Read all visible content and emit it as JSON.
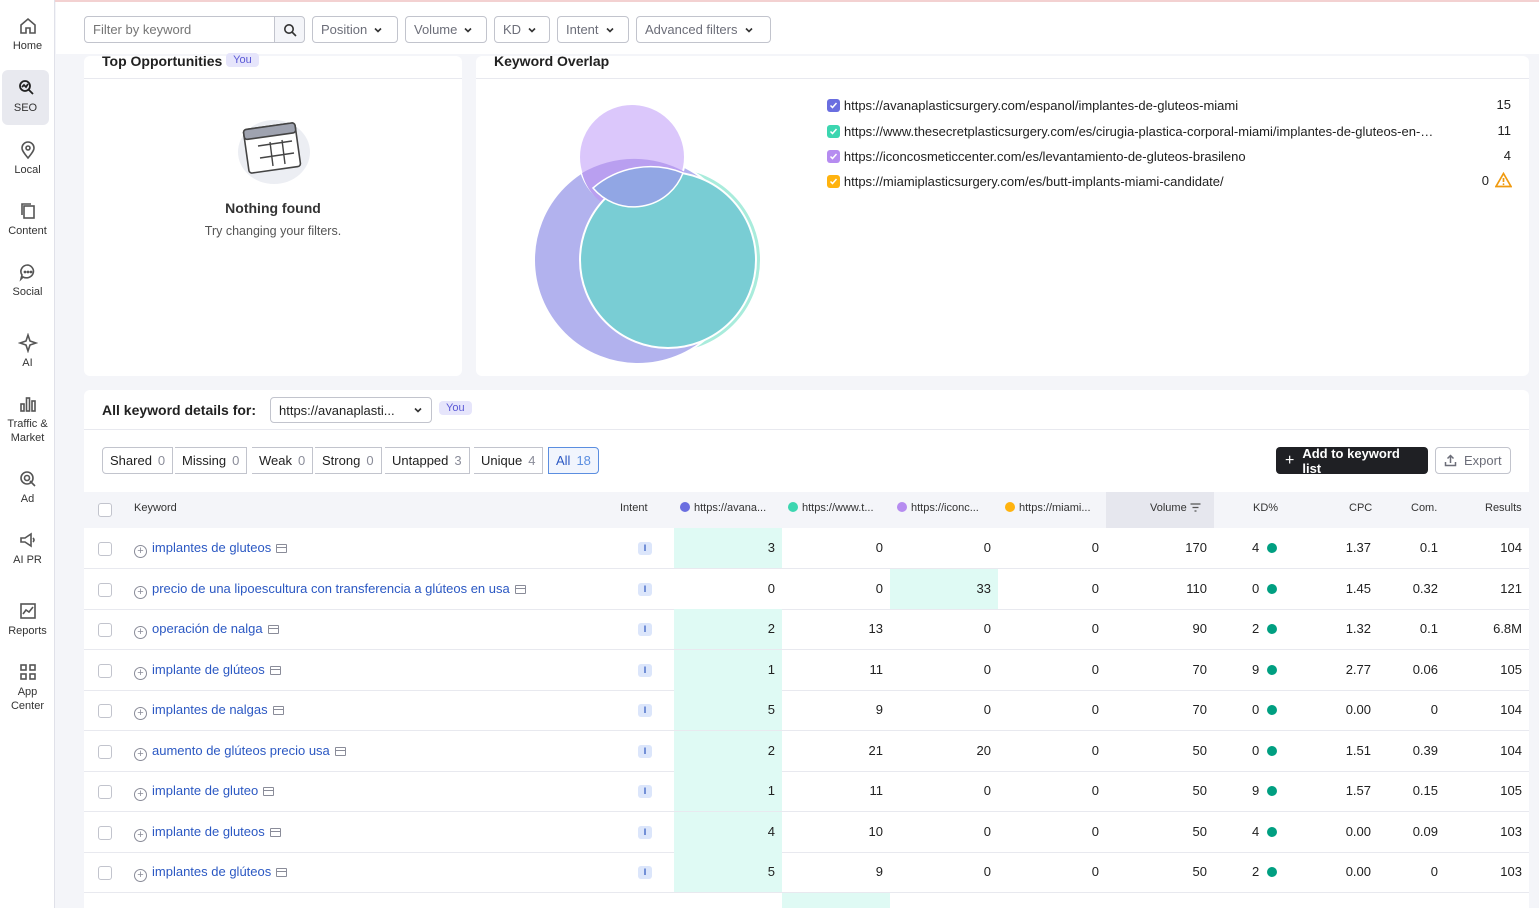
{
  "nav": [
    {
      "label": "Home",
      "icon": "home-icon"
    },
    {
      "label": "SEO",
      "icon": "seo-icon"
    },
    {
      "label": "Local",
      "icon": "location-pin-icon"
    },
    {
      "label": "Content",
      "icon": "content-icon"
    },
    {
      "label": "Social",
      "icon": "chat-bubble-icon"
    },
    {
      "label": "AI",
      "icon": "ai-icon"
    },
    {
      "label": "Traffic &",
      "label2": "Market",
      "icon": "bar-chart-icon"
    },
    {
      "label": "Ad",
      "icon": "ad-icon"
    },
    {
      "label": "AI PR",
      "icon": "megaphone-icon"
    },
    {
      "label": "Reports",
      "icon": "reports-icon"
    },
    {
      "label": "App",
      "label2": "Center",
      "icon": "grid-icon"
    }
  ],
  "filters": {
    "search_placeholder": "Filter by keyword",
    "position": "Position",
    "volume": "Volume",
    "kd": "KD",
    "intent": "Intent",
    "advanced": "Advanced filters"
  },
  "top_opportunities": {
    "title": "Top Opportunities",
    "badge": "You",
    "empty_title": "Nothing found",
    "empty_text": "Try changing your filters."
  },
  "overlap": {
    "title": "Keyword Overlap",
    "legend": [
      {
        "url": "https://avanaplasticsurgery.com/espanol/implantes-de-gluteos-miami",
        "count": "15",
        "color": "#6a6ee0"
      },
      {
        "url": "https://www.thesecretplasticsurgery.com/es/cirugia-plastica-corporal-miami/implantes-de-gluteos-en-…",
        "count": "11",
        "color": "#3cd6b0"
      },
      {
        "url": "https://iconcosmeticcenter.com/es/levantamiento-de-gluteos-brasileno",
        "count": "4",
        "color": "#b68cf0"
      },
      {
        "url": "https://miamiplasticsurgery.com/es/butt-implants-miami-candidate/",
        "count": "0",
        "color": "#ffb30f"
      }
    ]
  },
  "details": {
    "label": "All keyword details for:",
    "domain": "https://avanaplasti...",
    "badge": "You",
    "tabs": [
      {
        "label": "Shared",
        "count": "0"
      },
      {
        "label": "Missing",
        "count": "0"
      },
      {
        "label": "Weak",
        "count": "0"
      },
      {
        "label": "Strong",
        "count": "0"
      },
      {
        "label": "Untapped",
        "count": "3"
      },
      {
        "label": "Unique",
        "count": "4"
      },
      {
        "label": "All",
        "count": "18"
      }
    ],
    "add_button": "Add to keyword list",
    "export_button": "Export"
  },
  "table": {
    "headers": {
      "keyword": "Keyword",
      "intent": "Intent",
      "d1": "https://avana...",
      "d2": "https://www.t...",
      "d3": "https://iconc...",
      "d4": "https://miami...",
      "volume": "Volume",
      "kd": "KD%",
      "cpc": "CPC",
      "com": "Com.",
      "results": "Results"
    },
    "rows": [
      {
        "kw": "implantes de gluteos",
        "intent": "I",
        "d1": "3",
        "d2": "0",
        "d3": "0",
        "d4": "0",
        "vol": "170",
        "kd": "4",
        "cpc": "1.37",
        "com": "0.1",
        "res": "104"
      },
      {
        "kw": "precio de una lipoescultura con transferencia a glúteos en usa",
        "intent": "I",
        "d1": "0",
        "d2": "0",
        "d3": "33",
        "d4": "0",
        "vol": "110",
        "kd": "0",
        "cpc": "1.45",
        "com": "0.32",
        "res": "121"
      },
      {
        "kw": "operación de nalga",
        "intent": "I",
        "d1": "2",
        "d2": "13",
        "d3": "0",
        "d4": "0",
        "vol": "90",
        "kd": "2",
        "cpc": "1.32",
        "com": "0.1",
        "res": "6.8M"
      },
      {
        "kw": "implante de glúteos",
        "intent": "I",
        "d1": "1",
        "d2": "11",
        "d3": "0",
        "d4": "0",
        "vol": "70",
        "kd": "9",
        "cpc": "2.77",
        "com": "0.06",
        "res": "105"
      },
      {
        "kw": "implantes de nalgas",
        "intent": "I",
        "d1": "5",
        "d2": "9",
        "d3": "0",
        "d4": "0",
        "vol": "70",
        "kd": "0",
        "cpc": "0.00",
        "com": "0",
        "res": "104"
      },
      {
        "kw": "aumento de glúteos precio usa",
        "intent": "I",
        "d1": "2",
        "d2": "21",
        "d3": "20",
        "d4": "0",
        "vol": "50",
        "kd": "0",
        "cpc": "1.51",
        "com": "0.39",
        "res": "104"
      },
      {
        "kw": "implante de gluteo",
        "intent": "I",
        "d1": "1",
        "d2": "11",
        "d3": "0",
        "d4": "0",
        "vol": "50",
        "kd": "9",
        "cpc": "1.57",
        "com": "0.15",
        "res": "105"
      },
      {
        "kw": "implante de gluteos",
        "intent": "I",
        "d1": "4",
        "d2": "10",
        "d3": "0",
        "d4": "0",
        "vol": "50",
        "kd": "4",
        "cpc": "0.00",
        "com": "0.09",
        "res": "103"
      },
      {
        "kw": "implantes de glúteos",
        "intent": "I",
        "d1": "5",
        "d2": "9",
        "d3": "0",
        "d4": "0",
        "vol": "50",
        "kd": "2",
        "cpc": "0.00",
        "com": "0",
        "res": "103"
      }
    ]
  }
}
